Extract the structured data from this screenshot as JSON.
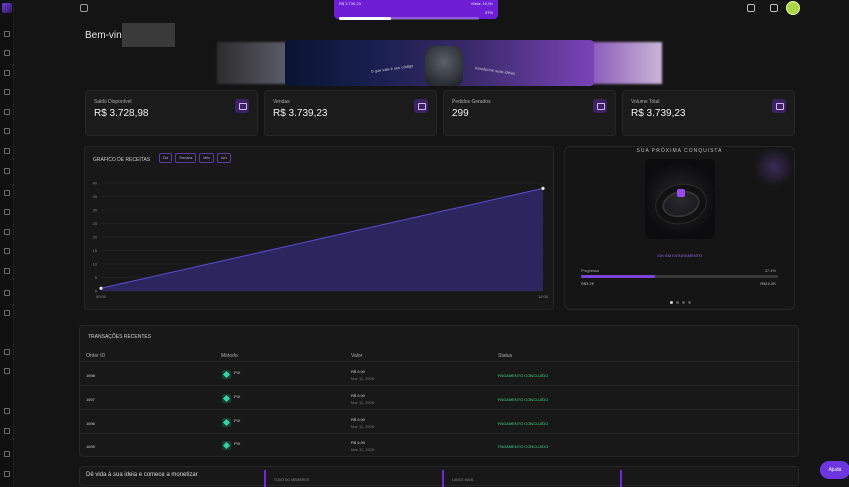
{
  "topbar": {
    "goal": {
      "current": "R$ 3.739,23",
      "target_label": "Meta: 10,0K",
      "progress": 0.37,
      "percent_label": "37%"
    }
  },
  "welcome": "Bem-vin",
  "banner": {
    "text_left": "0 que vale é seu código",
    "text_right": "transforme suas ideias"
  },
  "stats": [
    {
      "label": "Saldo Disponível",
      "value": "R$ 3.728,98",
      "icon": "wallet-icon"
    },
    {
      "label": "Vendas",
      "value": "R$ 3.739,23",
      "icon": "chart-up-icon"
    },
    {
      "label": "Pedidos Gerados",
      "value": "299",
      "icon": "list-icon"
    },
    {
      "label": "Volume Total",
      "value": "R$ 3.739,23",
      "icon": "cash-icon"
    }
  ],
  "revenue": {
    "title": "GRÁFICO DE RECEITAS",
    "filters": [
      "Dia",
      "Semana",
      "Mês",
      "Ano"
    ]
  },
  "chart_data": {
    "type": "area",
    "x": [
      "00:00",
      "14:00"
    ],
    "values": [
      1,
      38
    ],
    "yticks": [
      0,
      5,
      10,
      15,
      20,
      25,
      30,
      35,
      40
    ],
    "ylim": [
      0,
      40
    ],
    "title": "GRÁFICO DE RECEITAS",
    "xlabel": "",
    "ylabel": "",
    "colors": {
      "line": "#5b4bd4",
      "fill": "#2f2866"
    },
    "grid": true
  },
  "promo": {
    "title": "SUA PRÓXIMA CONQUISTA",
    "caption": "10K EM FATURAMENTO",
    "progress_label": "Progresso",
    "progress_pct_label": "37.4%",
    "progress": 0.374,
    "current": "R$3.7K",
    "target": "R$10.0K"
  },
  "transactions": {
    "title": "TRANSAÇÕES RECENTES",
    "columns": [
      "Order ID",
      "Método",
      "Valor",
      "Status"
    ],
    "rows": [
      {
        "id": "1698",
        "method": "PIX",
        "value": "R$ 9,90",
        "date": "Mar 11, 2026",
        "status": "PAGAMENTO CONCLUÍDO"
      },
      {
        "id": "1697",
        "method": "PIX",
        "value": "R$ 9,90",
        "date": "Mar 11, 2026",
        "status": "PAGAMENTO CONCLUÍDO"
      },
      {
        "id": "1696",
        "method": "PIX",
        "value": "R$ 9,90",
        "date": "Mar 11, 2026",
        "status": "PAGAMENTO CONCLUÍDO"
      },
      {
        "id": "1695",
        "method": "PIX",
        "value": "R$ 9,90",
        "date": "Mar 11, 2026",
        "status": "PAGAMENTO CONCLUÍDO"
      }
    ]
  },
  "bottom": {
    "title": "Dê vida à sua ideia e comece a monetizar",
    "card1": "TUDO DO MEMBROS",
    "card2": "LANCE MAIS"
  },
  "help_label": "Ajuda",
  "colors": {
    "accent": "#6e1fd6",
    "success": "#3fd48f",
    "bg": "#141414"
  }
}
